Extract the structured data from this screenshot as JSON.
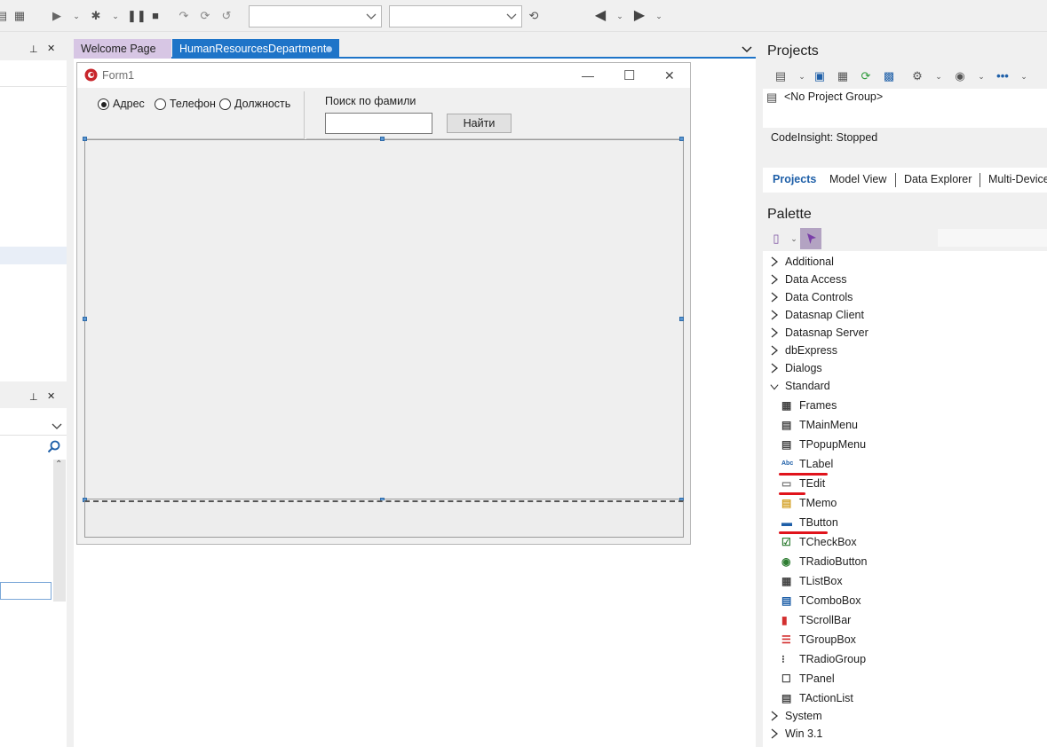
{
  "toolbar": {
    "icons": [
      "run-icon",
      "run-dropdown-icon",
      "debug-icon",
      "pause-icon",
      "stop-icon",
      "step-over-icon",
      "step-into-icon",
      "run-until-icon",
      "back-icon",
      "forward-icon"
    ],
    "config_combo_value": "",
    "platform_combo_value": ""
  },
  "tabs": {
    "welcome": "Welcome Page",
    "hr": "HumanResourcesDepartment"
  },
  "form": {
    "title": "Form1",
    "radios": [
      "Адрес",
      "Телефон",
      "Должность"
    ],
    "radio_checked_index": 0,
    "search_label": "Поиск по фамили",
    "search_value": "",
    "find_button": "Найти"
  },
  "projects": {
    "title": "Projects",
    "group": "<No Project Group>",
    "codeinsight": "CodeInsight: Stopped",
    "tabs": [
      "Projects",
      "Model View",
      "Data Explorer",
      "Multi-Device"
    ]
  },
  "palette": {
    "title": "Palette",
    "categories_before": [
      "Additional",
      "Data Access",
      "Data Controls",
      "Datasnap Client",
      "Datasnap Server",
      "dbExpress",
      "Dialogs"
    ],
    "expanded_category": "Standard",
    "components": [
      "Frames",
      "TMainMenu",
      "TPopupMenu",
      "TLabel",
      "TEdit",
      "TMemo",
      "TButton",
      "TCheckBox",
      "TRadioButton",
      "TListBox",
      "TComboBox",
      "TScrollBar",
      "TGroupBox",
      "TRadioGroup",
      "TPanel",
      "TActionList"
    ],
    "categories_after": [
      "System",
      "Win 3.1"
    ],
    "highlight_color": "#e0131b"
  }
}
